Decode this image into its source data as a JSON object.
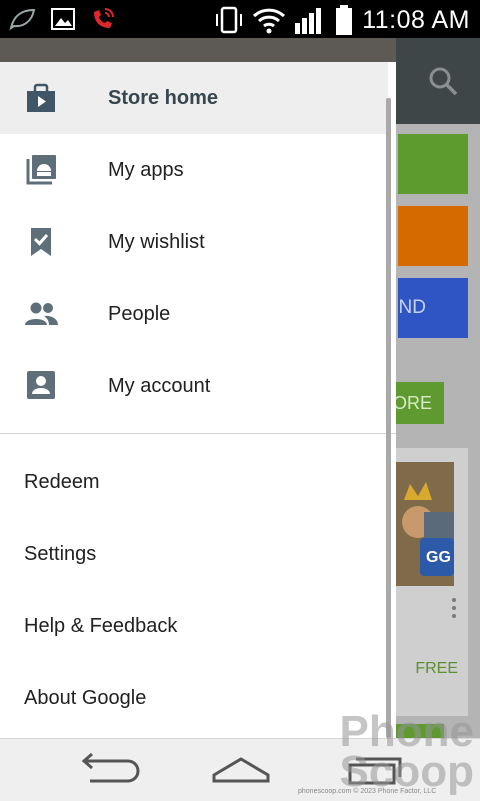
{
  "status_bar": {
    "time": "11:08 AM",
    "icons": [
      "leaf-icon",
      "image-icon",
      "phone-call-icon",
      "vibrate-icon",
      "wifi-icon",
      "signal-icon",
      "battery-icon"
    ]
  },
  "drawer": {
    "primary_items": [
      {
        "label": "Store home",
        "icon": "store-bag-icon",
        "active": true
      },
      {
        "label": "My apps",
        "icon": "android-apps-icon",
        "active": false
      },
      {
        "label": "My wishlist",
        "icon": "bookmark-check-icon",
        "active": false
      },
      {
        "label": "People",
        "icon": "people-icon",
        "active": false
      },
      {
        "label": "My account",
        "icon": "account-icon",
        "active": false
      }
    ],
    "secondary_items": [
      {
        "label": "Redeem"
      },
      {
        "label": "Settings"
      },
      {
        "label": "Help & Feedback"
      },
      {
        "label": "About Google"
      }
    ]
  },
  "background": {
    "tile_blue_text": "ND",
    "more_button_text": "ORE",
    "free_label": "FREE"
  },
  "watermark": {
    "line1": "Phone",
    "line2": "Scoop",
    "credit": "phonescoop.com © 2023 Phone Factor, LLC"
  },
  "colors": {
    "status_bar": "#000000",
    "drawer_active_bg": "#eeeeee",
    "icon_color": "#607080",
    "green": "#5c9b2e",
    "orange": "#d46a00",
    "blue": "#2f55c4"
  }
}
